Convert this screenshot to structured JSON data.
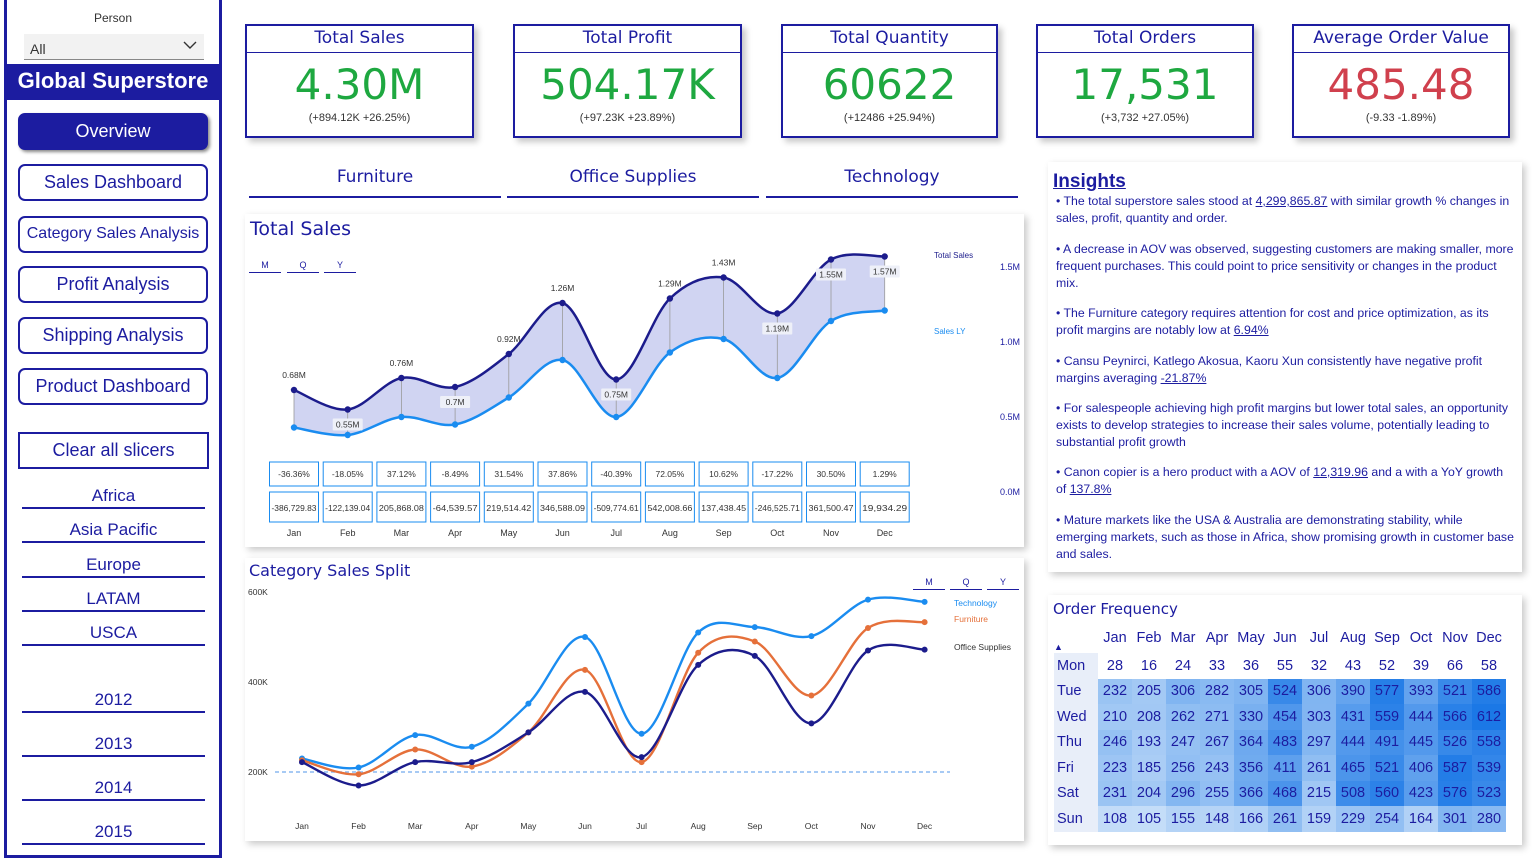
{
  "sidebar": {
    "person_label": "Person",
    "person_value": "All",
    "brand": "Global Superstore",
    "nav": [
      "Overview",
      "Sales Dashboard",
      "Category Sales Analysis",
      "Profit Analysis",
      "Shipping Analysis",
      "Product Dashboard"
    ],
    "clear": "Clear all slicers",
    "regions": [
      "Africa",
      "Asia Pacific",
      "Europe",
      "LATAM",
      "USCA"
    ],
    "years": [
      "2012",
      "2013",
      "2014",
      "2015"
    ]
  },
  "kpis": [
    {
      "title": "Total Sales",
      "value": "4.30M",
      "delta": "(+894.12K +26.25%)",
      "color": "#1ea840"
    },
    {
      "title": "Total Profit",
      "value": "504.17K",
      "delta": "(+97.23K +23.89%)",
      "color": "#1ea840"
    },
    {
      "title": "Total Quantity",
      "value": "60622",
      "delta": "(+12486 +25.94%)",
      "color": "#1ea840"
    },
    {
      "title": "Total Orders",
      "value": "17,531",
      "delta": "(+3,732 +27.05%)",
      "color": "#1ea840"
    },
    {
      "title": "Average Order Value",
      "value": "485.48",
      "delta": "(-9.33 -1.89%)",
      "color": "#d0404d"
    }
  ],
  "categories": [
    "Furniture",
    "Office Supplies",
    "Technology"
  ],
  "total_sales_panel": {
    "title": "Total Sales",
    "toggles": [
      "M",
      "Q",
      "Y"
    ],
    "legend_sales": "Total Sales",
    "legend_ly": "Sales LY",
    "pct": [
      "-36.36%",
      "-18.05%",
      "37.12%",
      "-8.49%",
      "31.54%",
      "37.86%",
      "-40.39%",
      "72.05%",
      "10.62%",
      "-17.22%",
      "30.50%",
      "1.29%"
    ],
    "diff": [
      "-386,729.83",
      "-122,139.04",
      "205,868.08",
      "-64,539.57",
      "219,514.42",
      "346,588.09",
      "-509,774.61",
      "542,008.66",
      "137,438.45",
      "-246,525.71",
      "361,500.47",
      "19,934.29"
    ]
  },
  "category_split_panel": {
    "title": "Category Sales Split",
    "toggles": [
      "M",
      "Q",
      "Y"
    ]
  },
  "insights": {
    "title": "Insights",
    "items": [
      [
        "The total superstore sales stood at ",
        "4,299,865.87",
        " with similar growth % changes in sales, profit, quantity and order."
      ],
      [
        "A decrease in AOV was observed, suggesting customers are making smaller, more frequent purchases. This could point to price sensitivity or changes in the product mix.",
        "",
        ""
      ],
      [
        "The Furniture category requires attention for cost and price optimization, as its profit margins are notably low at  ",
        "6.94%",
        ""
      ],
      [
        "Cansu Peynirci, Katlego Akosua, Kaoru Xun consistently have negative profit margins averaging ",
        "-21.87%",
        ""
      ],
      [
        "For salespeople achieving high profit margins but lower total sales, an opportunity exists to develop strategies to increase their sales volume, potentially leading to substantial profit growth",
        "",
        ""
      ],
      [
        "Canon copier is a hero product with a AOV of ",
        "12,319.96",
        " and a with a YoY growth of "
      ],
      [
        "Mature markets like the USA & Australia are demonstrating stability, while emerging markets, such as those in Africa, show promising growth in customer base and sales.",
        "",
        ""
      ]
    ],
    "canon_growth": "137.8%"
  },
  "order_frequency": {
    "title": "Order Frequency",
    "months": [
      "Jan",
      "Feb",
      "Mar",
      "Apr",
      "May",
      "Jun",
      "Jul",
      "Aug",
      "Sep",
      "Oct",
      "Nov",
      "Dec"
    ],
    "rows": [
      {
        "day": "Mon",
        "values": [
          28,
          16,
          24,
          33,
          36,
          55,
          32,
          43,
          52,
          39,
          66,
          58
        ]
      },
      {
        "day": "Tue",
        "values": [
          232,
          205,
          306,
          282,
          305,
          524,
          306,
          390,
          577,
          393,
          521,
          586
        ]
      },
      {
        "day": "Wed",
        "values": [
          210,
          208,
          262,
          271,
          330,
          454,
          303,
          431,
          559,
          444,
          566,
          612
        ]
      },
      {
        "day": "Thu",
        "values": [
          246,
          193,
          247,
          267,
          364,
          483,
          297,
          444,
          491,
          445,
          526,
          558
        ]
      },
      {
        "day": "Fri",
        "values": [
          223,
          185,
          256,
          243,
          356,
          411,
          261,
          465,
          521,
          406,
          587,
          539
        ]
      },
      {
        "day": "Sat",
        "values": [
          231,
          204,
          296,
          255,
          366,
          468,
          215,
          508,
          560,
          423,
          576,
          523
        ]
      },
      {
        "day": "Sun",
        "values": [
          108,
          105,
          155,
          148,
          166,
          261,
          159,
          229,
          254,
          164,
          301,
          280
        ]
      }
    ]
  },
  "chart_data": [
    {
      "type": "line",
      "title": "Total Sales",
      "x": [
        "Jan",
        "Feb",
        "Mar",
        "Apr",
        "May",
        "Jun",
        "Jul",
        "Aug",
        "Sep",
        "Oct",
        "Nov",
        "Dec"
      ],
      "series": [
        {
          "name": "Total Sales",
          "values": [
            0.68,
            0.55,
            0.76,
            0.7,
            0.92,
            1.26,
            0.75,
            1.29,
            1.43,
            1.19,
            1.55,
            1.57
          ],
          "labels": [
            "0.68M",
            "0.55M",
            "0.76M",
            "0.7M",
            "0.92M",
            "1.26M",
            "0.75M",
            "1.29M",
            "1.43M",
            "1.19M",
            "1.55M",
            "1.57M"
          ]
        },
        {
          "name": "Sales LY",
          "values": [
            0.43,
            0.38,
            0.5,
            0.45,
            0.63,
            0.88,
            0.5,
            0.93,
            1.02,
            0.76,
            1.14,
            1.21
          ]
        }
      ],
      "y_ticks": [
        "1.5M",
        "1.0M",
        "0.5M",
        "0.0M"
      ],
      "ylim": [
        0,
        1.67
      ]
    },
    {
      "type": "line",
      "title": "Category Sales Split",
      "x": [
        "Jan",
        "Feb",
        "Mar",
        "Apr",
        "May",
        "Jun",
        "Jul",
        "Aug",
        "Sep",
        "Oct",
        "Nov",
        "Dec"
      ],
      "series": [
        {
          "name": "Technology",
          "values": [
            230,
            210,
            282,
            256,
            352,
            500,
            285,
            510,
            522,
            502,
            583,
            578
          ],
          "color": "#1a8cf0"
        },
        {
          "name": "Furniture",
          "values": [
            226,
            195,
            250,
            212,
            288,
            427,
            222,
            465,
            490,
            370,
            520,
            533
          ],
          "color": "#e5703a"
        },
        {
          "name": "Office Supplies",
          "values": [
            222,
            170,
            222,
            222,
            288,
            378,
            233,
            438,
            458,
            308,
            470,
            472
          ],
          "color": "#1c1c8c"
        }
      ],
      "y_ticks": [
        "600K",
        "400K",
        "200K"
      ],
      "ylim": [
        150,
        600
      ]
    }
  ]
}
